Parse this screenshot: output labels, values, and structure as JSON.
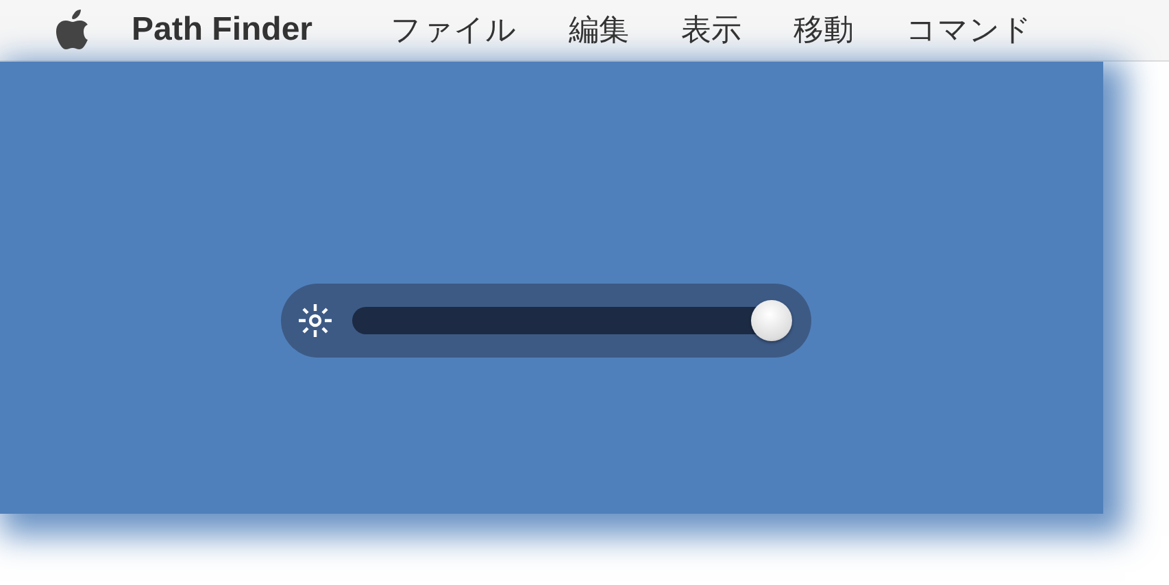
{
  "menu_bar": {
    "app_name": "Path Finder",
    "items": [
      {
        "label": "ファイル"
      },
      {
        "label": "編集"
      },
      {
        "label": "表示"
      },
      {
        "label": "移動"
      },
      {
        "label": "コマンド"
      }
    ]
  },
  "brightness_slider": {
    "level": 1.0
  }
}
